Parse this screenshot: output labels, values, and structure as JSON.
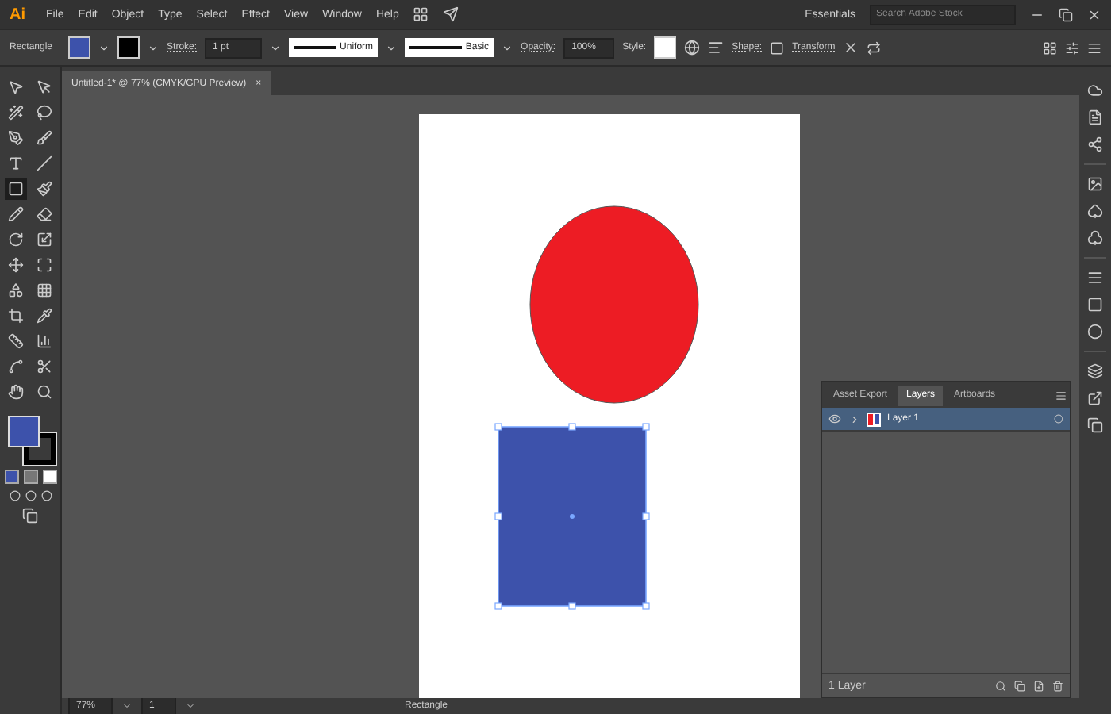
{
  "app": {
    "logo": "Ai"
  },
  "menu": [
    "File",
    "Edit",
    "Object",
    "Type",
    "Select",
    "Effect",
    "View",
    "Window",
    "Help"
  ],
  "workspace": {
    "label": "Essentials",
    "search": {
      "placeholder": "Search Adobe Stock"
    }
  },
  "control_bar": {
    "object_type": "Rectangle",
    "stroke_label": "Stroke:",
    "stroke_weight": "1 pt",
    "profile": "Uniform",
    "brush": "Basic",
    "opacity_label": "Opacity:",
    "opacity": "100%",
    "style_label": "Style:",
    "shape_label": "Shape:",
    "transform_label": "Transform"
  },
  "document_tab": {
    "title": "Untitled-1* @ 77% (CMYK/GPU Preview)",
    "close": "×"
  },
  "toolbar": {
    "tools": [
      {
        "selected": false
      },
      {
        "selected": false
      },
      {
        "selected": false
      },
      {
        "selected": false
      },
      {
        "selected": false
      },
      {
        "selected": false
      },
      {
        "selected": false
      },
      {
        "selected": false
      },
      {
        "selected": true
      },
      {
        "selected": false
      },
      {
        "selected": false
      },
      {
        "selected": false
      },
      {
        "selected": false
      },
      {
        "selected": false
      },
      {
        "selected": false
      },
      {
        "selected": false
      },
      {
        "selected": false
      },
      {
        "selected": false
      },
      {
        "selected": false
      },
      {
        "selected": false
      },
      {
        "selected": false
      },
      {
        "selected": false
      },
      {
        "selected": false
      },
      {
        "selected": false
      },
      {
        "selected": false
      },
      {
        "selected": false
      }
    ]
  },
  "artboard": {
    "shapes": [
      {
        "kind": "ellipse",
        "color": "#ed1c24",
        "selected": false
      },
      {
        "kind": "rectangle",
        "color": "#3d52ab",
        "selected": true
      }
    ]
  },
  "layers_panel": {
    "tabs": [
      {
        "label": "Asset Export",
        "selected": false
      },
      {
        "label": "Layers",
        "selected": true
      },
      {
        "label": "Artboards",
        "selected": false
      }
    ],
    "layers": [
      {
        "name": "Layer 1",
        "visible": true,
        "selected": true,
        "expanded": false
      }
    ],
    "footer": "1 Layer"
  },
  "status_bar": {
    "zoom": "77%",
    "artboard": "1",
    "tool": "Rectangle"
  }
}
